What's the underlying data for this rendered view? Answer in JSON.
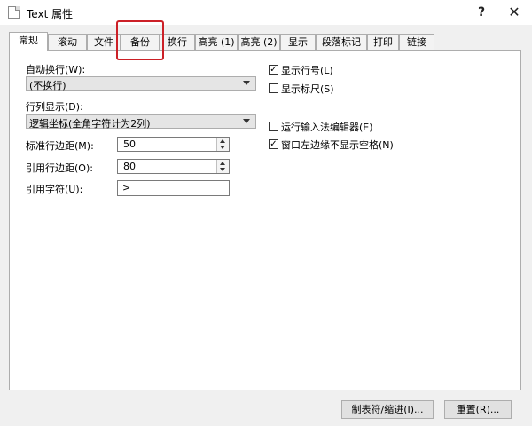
{
  "window": {
    "title": "Text 属性",
    "help_label": "?",
    "close_label": "✕"
  },
  "tabs": [
    {
      "label": "常规",
      "active": true
    },
    {
      "label": "滚动"
    },
    {
      "label": "文件"
    },
    {
      "label": "备份",
      "highlighted": true
    },
    {
      "label": "换行"
    },
    {
      "label": "高亮 (1)"
    },
    {
      "label": "高亮 (2)"
    },
    {
      "label": "显示"
    },
    {
      "label": "段落标记"
    },
    {
      "label": "打印"
    },
    {
      "label": "链接"
    }
  ],
  "general": {
    "wrap_label": "自动换行(W):",
    "wrap_value": "(不换行)",
    "col_label": "行列显示(D):",
    "col_value": "逻辑坐标(全角字符计为2列)",
    "std_margin_label": "标准行边距(M):",
    "std_margin_value": "50",
    "quote_margin_label": "引用行边距(O):",
    "quote_margin_value": "80",
    "quote_char_label": "引用字符(U):",
    "quote_char_value": ">",
    "show_line_numbers": {
      "label": "显示行号(L)",
      "checked": true
    },
    "show_ruler": {
      "label": "显示标尺(S)",
      "checked": false
    },
    "run_ime": {
      "label": "运行输入法编辑器(E)",
      "checked": false
    },
    "hide_left_space": {
      "label": "窗口左边缘不显示空格(N)",
      "checked": true
    }
  },
  "buttons": {
    "tabs_indent": "制表符/缩进(I)...",
    "reset": "重置(R)..."
  },
  "icons": {
    "window": "document-icon",
    "checked_glyph": "✓"
  },
  "colors": {
    "highlight": "#cc2027"
  }
}
